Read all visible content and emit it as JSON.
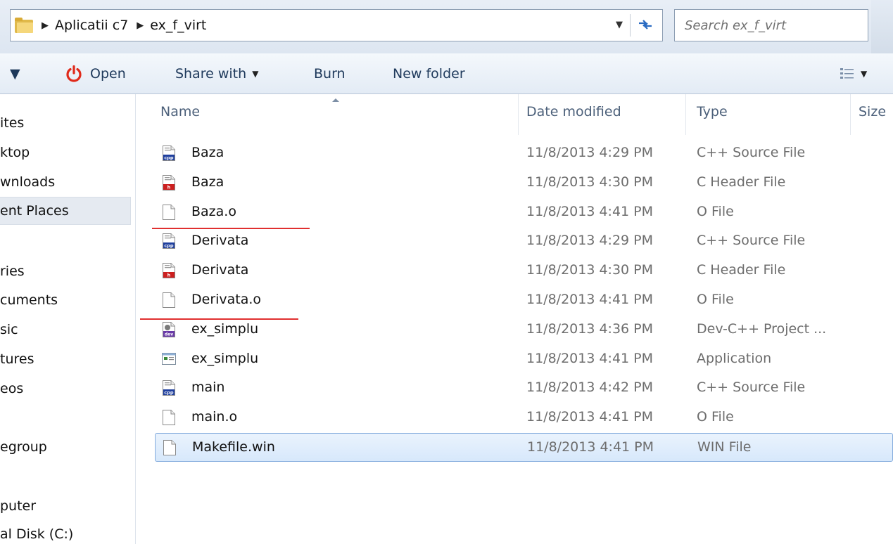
{
  "address_bar": {
    "breadcrumbs": [
      "Aplicatii c7",
      "ex_f_virt"
    ],
    "search_placeholder": "Search ex_f_virt"
  },
  "toolbar": {
    "organize_caret": "▼",
    "open_label": "Open",
    "share_label": "Share with",
    "burn_label": "Burn",
    "new_folder_label": "New folder"
  },
  "nav": {
    "items": [
      "ites",
      "ktop",
      "wnloads",
      "ent Places",
      "ries",
      "cuments",
      "sic",
      "tures",
      "eos",
      "egroup",
      "puter",
      "al Disk (C:)"
    ],
    "selected_index": 3
  },
  "columns": {
    "name": "Name",
    "date": "Date modified",
    "type": "Type",
    "size": "Size"
  },
  "files": [
    {
      "name": "Baza",
      "date": "11/8/2013 4:29 PM",
      "type": "C++ Source File",
      "icon": "cpp-file-icon"
    },
    {
      "name": "Baza",
      "date": "11/8/2013 4:30 PM",
      "type": "C Header File",
      "icon": "header-file-icon"
    },
    {
      "name": "Baza.o",
      "date": "11/8/2013 4:41 PM",
      "type": "O File",
      "icon": "blank-file-icon"
    },
    {
      "name": "Derivata",
      "date": "11/8/2013 4:29 PM",
      "type": "C++ Source File",
      "icon": "cpp-file-icon"
    },
    {
      "name": "Derivata",
      "date": "11/8/2013 4:30 PM",
      "type": "C Header File",
      "icon": "header-file-icon"
    },
    {
      "name": "Derivata.o",
      "date": "11/8/2013 4:41 PM",
      "type": "O File",
      "icon": "blank-file-icon"
    },
    {
      "name": "ex_simplu",
      "date": "11/8/2013 4:36 PM",
      "type": "Dev-C++ Project ...",
      "icon": "devcpp-project-icon"
    },
    {
      "name": "ex_simplu",
      "date": "11/8/2013 4:41 PM",
      "type": "Application",
      "icon": "application-icon"
    },
    {
      "name": "main",
      "date": "11/8/2013 4:42 PM",
      "type": "C++ Source File",
      "icon": "cpp-file-icon"
    },
    {
      "name": "main.o",
      "date": "11/8/2013 4:41 PM",
      "type": "O File",
      "icon": "blank-file-icon"
    },
    {
      "name": "Makefile.win",
      "date": "11/8/2013 4:41 PM",
      "type": "WIN File",
      "icon": "blank-file-icon"
    }
  ],
  "selected_file_index": 10,
  "colors": {
    "annotation_red": "#e03030",
    "selection_border": "#84acdd",
    "toolbar_text": "#1e395b"
  }
}
